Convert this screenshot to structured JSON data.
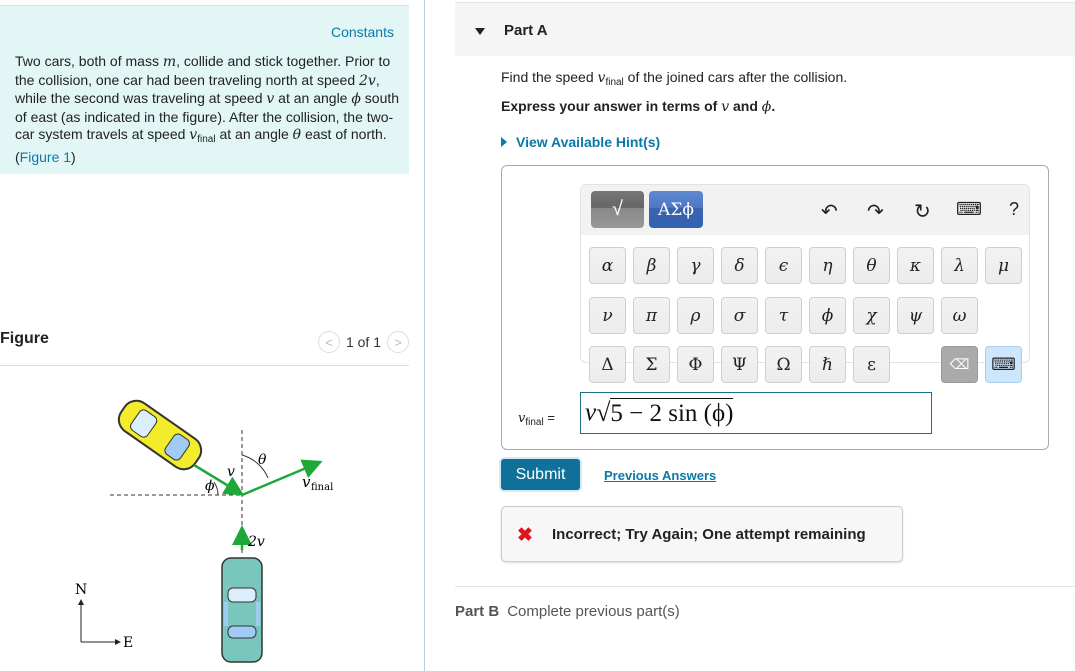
{
  "intro": {
    "constants_link": "Constants",
    "text_parts": {
      "p1": "Two cars, both of mass ",
      "m": "m",
      "p2": ", collide and stick together. Prior to the collision, one car had been traveling north at speed ",
      "two_v": "2v",
      "p3": ", while the second was traveling at speed ",
      "v": "v",
      "p4": " at an angle ",
      "phi": "ϕ",
      "p5": " south of east (as indicated in the figure). After the collision, the two-car system travels at speed ",
      "vfinal": "v",
      "vfinal_sub": "final",
      "p6": " at an angle ",
      "theta": "θ",
      "p7": " east of north. (",
      "figure_link": "Figure 1",
      "p8": ")"
    }
  },
  "figure": {
    "title": "Figure",
    "pager_text": "1 of 1",
    "prev_icon": "chevron-left-icon",
    "next_icon": "chevron-right-icon",
    "labels": {
      "phi": "ϕ",
      "v": "v",
      "theta": "θ",
      "vfinal": "v",
      "vfinal_sub": "final",
      "two_v": "2v",
      "north": "N",
      "east": "E"
    },
    "colors": {
      "arrow": "#1fa83a",
      "car1": "#f2ec2a",
      "car2": "#79c6bd"
    }
  },
  "partA": {
    "title": "Part A",
    "prompt_pre": "Find the speed ",
    "prompt_var": "v",
    "prompt_sub": "final",
    "prompt_post": " of the joined cars after the collision.",
    "express_pre": "Express your answer in terms of ",
    "express_v": "v",
    "express_and": " and ",
    "express_phi": "ϕ",
    "express_post": ".",
    "hint_label": "View Available Hint(s)",
    "palette": {
      "template_label": "√",
      "greek_label": "ΑΣϕ",
      "tools": {
        "undo": "↶",
        "redo": "↷",
        "reset": "↻",
        "keyboard": "⌨",
        "help": "?"
      },
      "row1": [
        "α",
        "β",
        "γ",
        "δ",
        "ϵ",
        "η",
        "θ",
        "κ",
        "λ",
        "μ"
      ],
      "row2": [
        "ν",
        "π",
        "ρ",
        "σ",
        "τ",
        "ϕ",
        "χ",
        "ψ",
        "ω"
      ],
      "row3": [
        "Δ",
        "Σ",
        "Φ",
        "Ψ",
        "Ω",
        "ℏ",
        "ε"
      ],
      "backspace": "⌫",
      "keyboard_toggle": "⌨"
    },
    "answer_label_var": "v",
    "answer_label_sub": "final",
    "answer_label_eq": " =",
    "answer_value": "v√5 − 2 sin (ϕ)",
    "answer_v": "v",
    "answer_radicand": "5 − 2 sin (ϕ)",
    "submit_label": "Submit",
    "previous_answers_label": "Previous Answers",
    "feedback_icon": "✖",
    "feedback_text": "Incorrect; Try Again; One attempt remaining",
    "feedback_color": "#e0141e"
  },
  "partB": {
    "title": "Part B",
    "status": "Complete previous part(s)"
  }
}
